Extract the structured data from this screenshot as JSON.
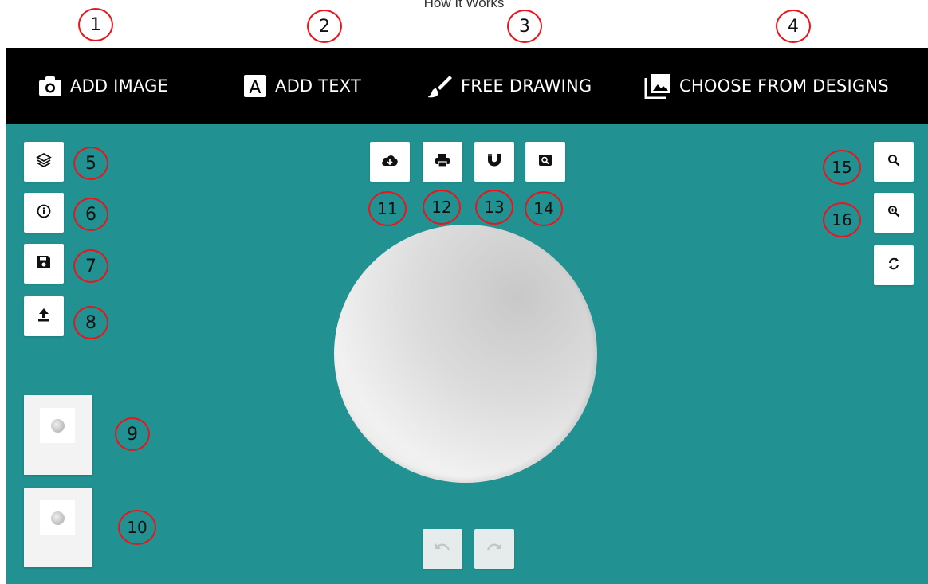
{
  "page": {
    "heading": "How It Works"
  },
  "toolbar": {
    "tabs": [
      {
        "label": "ADD IMAGE",
        "icon": "camera-icon"
      },
      {
        "label": "ADD TEXT",
        "icon": "text-icon"
      },
      {
        "label": "FREE DRAWING",
        "icon": "brush-icon"
      },
      {
        "label": "CHOOSE FROM DESIGNS",
        "icon": "gallery-icon"
      }
    ]
  },
  "left_tools": [
    "layers-icon",
    "info-icon",
    "save-icon",
    "upload-icon"
  ],
  "top_tools": [
    "cloud-download-icon",
    "print-icon",
    "magnet-icon",
    "search-box-icon"
  ],
  "right_tools": [
    "zoom-out-icon",
    "zoom-in-icon",
    "reset-icon"
  ],
  "history_tools": [
    "undo-icon",
    "redo-icon"
  ],
  "callouts": {
    "c1": "1",
    "c2": "2",
    "c3": "3",
    "c4": "4",
    "c5": "5",
    "c6": "6",
    "c7": "7",
    "c8": "8",
    "c9": "9",
    "c10": "10",
    "c11": "11",
    "c12": "12",
    "c13": "13",
    "c14": "14",
    "c15": "15",
    "c16": "16"
  },
  "colors": {
    "canvas_background": "#219192",
    "toolbar_background": "#000000",
    "callout_ring": "#e8161c"
  }
}
